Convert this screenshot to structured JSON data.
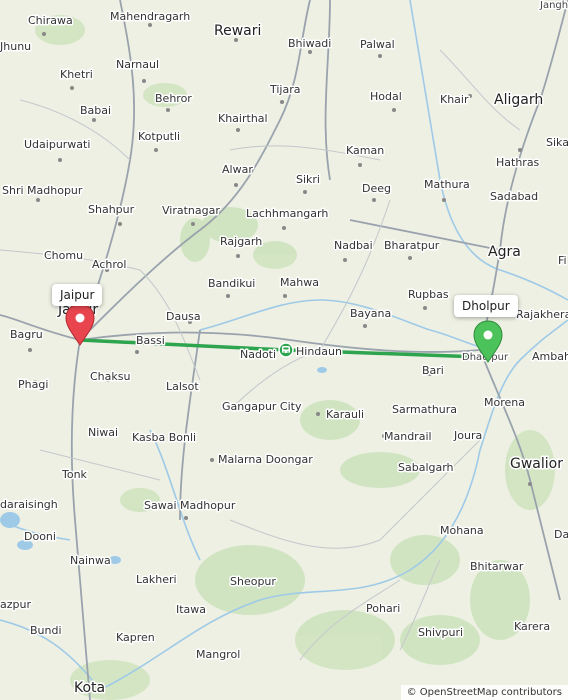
{
  "map": {
    "attribution": "© OpenStreetMap contributors",
    "route_color": "#2ea44f",
    "start_marker_color": "#e8454f",
    "end_marker_color": "#4cc35a",
    "route": {
      "from": "Jaipur",
      "to": "Dholpur",
      "via_icon": "train-icon",
      "via_label": "Hindaun"
    },
    "callouts": {
      "start": "Jaipur",
      "end": "Dholpur"
    },
    "places": [
      {
        "name": "Chirawa"
      },
      {
        "name": "Mahendragarh"
      },
      {
        "name": "Rewari"
      },
      {
        "name": "Bhiwadi"
      },
      {
        "name": "Palwal"
      },
      {
        "name": "Jhunu"
      },
      {
        "name": "Narnaul"
      },
      {
        "name": "Khetri"
      },
      {
        "name": "Behror"
      },
      {
        "name": "Tijara"
      },
      {
        "name": "Hodal"
      },
      {
        "name": "Khair"
      },
      {
        "name": "Aligarh"
      },
      {
        "name": "Babai"
      },
      {
        "name": "Khairthal"
      },
      {
        "name": "Udaipurwati"
      },
      {
        "name": "Kotputli"
      },
      {
        "name": "Kaman"
      },
      {
        "name": "Sika"
      },
      {
        "name": "Hathras"
      },
      {
        "name": "Alwar"
      },
      {
        "name": "Sikri"
      },
      {
        "name": "Deeg"
      },
      {
        "name": "Mathura"
      },
      {
        "name": "Shri Madhopur"
      },
      {
        "name": "Sadabad"
      },
      {
        "name": "Shahpur"
      },
      {
        "name": "Viratnagar"
      },
      {
        "name": "Lachhmangarh"
      },
      {
        "name": "Rajgarh"
      },
      {
        "name": "Nadbai"
      },
      {
        "name": "Bharatpur"
      },
      {
        "name": "Agra"
      },
      {
        "name": "Chomu"
      },
      {
        "name": "Achrol"
      },
      {
        "name": "Bandikui"
      },
      {
        "name": "Mahwa"
      },
      {
        "name": "Rupbas"
      },
      {
        "name": "Fi"
      },
      {
        "name": "Jaipur"
      },
      {
        "name": "Dausa"
      },
      {
        "name": "Bayana"
      },
      {
        "name": "Rajakhera"
      },
      {
        "name": "Bagru"
      },
      {
        "name": "Bassi"
      },
      {
        "name": "Nadoti"
      },
      {
        "name": "Hindaun"
      },
      {
        "name": "Dhaulpur"
      },
      {
        "name": "Ambah"
      },
      {
        "name": "Phagi"
      },
      {
        "name": "Chaksu"
      },
      {
        "name": "Lalsot"
      },
      {
        "name": "Bari"
      },
      {
        "name": "Gangapur City"
      },
      {
        "name": "Karauli"
      },
      {
        "name": "Sarmathura"
      },
      {
        "name": "Morena"
      },
      {
        "name": "Niwai"
      },
      {
        "name": "Kasba Bonli"
      },
      {
        "name": "Mandrail"
      },
      {
        "name": "Joura"
      },
      {
        "name": "Malarna Doongar"
      },
      {
        "name": "Sabalgarh"
      },
      {
        "name": "Gwalior"
      },
      {
        "name": "Tonk"
      },
      {
        "name": "daraisingh"
      },
      {
        "name": "Sawai Madhopur"
      },
      {
        "name": "Dooni"
      },
      {
        "name": "Da"
      },
      {
        "name": "Mohana"
      },
      {
        "name": "Nainwa"
      },
      {
        "name": "Bhitarwar"
      },
      {
        "name": "Lakheri"
      },
      {
        "name": "Sheopur"
      },
      {
        "name": "Pohari"
      },
      {
        "name": "azpur"
      },
      {
        "name": "Itawa"
      },
      {
        "name": "Karera"
      },
      {
        "name": "Bundi"
      },
      {
        "name": "Kapren"
      },
      {
        "name": "Shivpuri"
      },
      {
        "name": "Mangrol"
      },
      {
        "name": "Kota"
      },
      {
        "name": "Jangh"
      },
      {
        "name": "Jaipur"
      }
    ]
  }
}
